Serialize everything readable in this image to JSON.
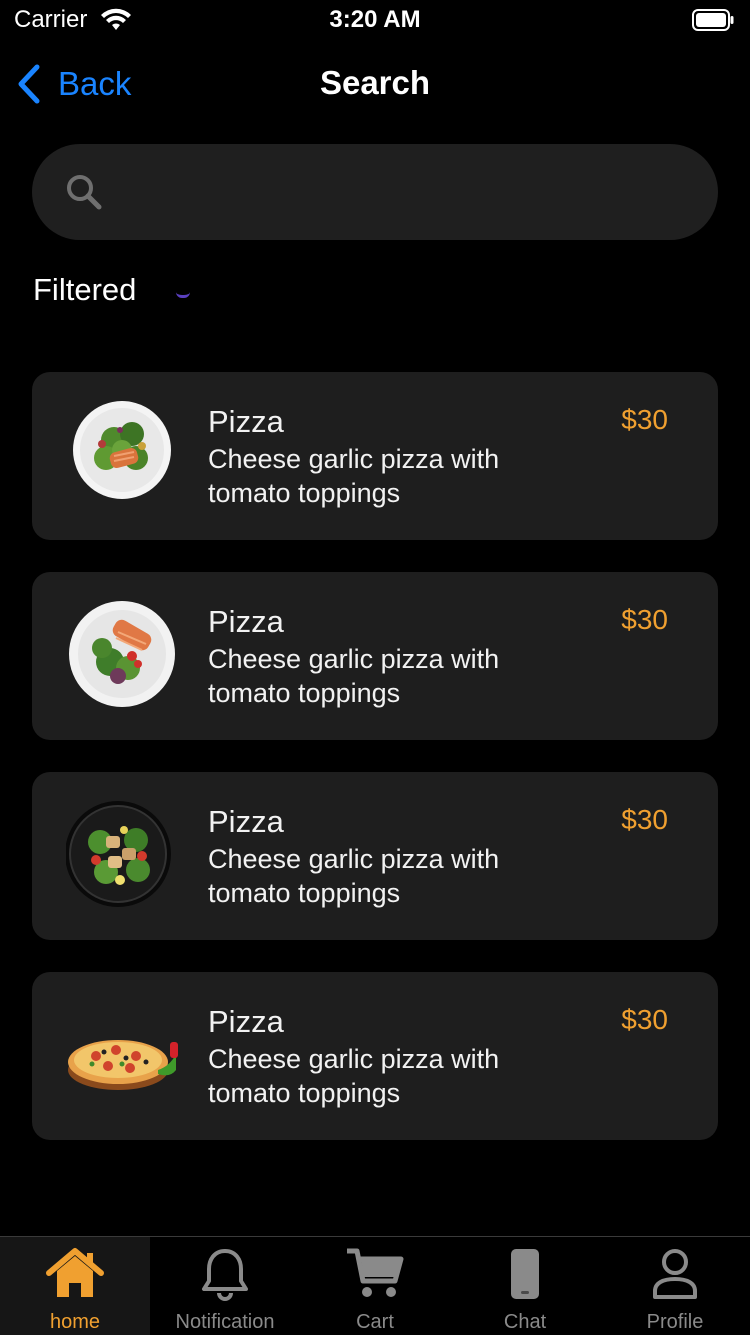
{
  "status_bar": {
    "carrier": "Carrier",
    "time": "3:20 AM"
  },
  "nav": {
    "back_label": "Back",
    "title": "Search"
  },
  "search": {
    "value": "",
    "placeholder": ""
  },
  "filter": {
    "label": "Filtered"
  },
  "results": [
    {
      "name": "Pizza",
      "description": "Cheese garlic pizza with tomato toppings",
      "price": "$30",
      "image": "salmon-salad-plate"
    },
    {
      "name": "Pizza",
      "description": "Cheese garlic pizza with tomato toppings",
      "price": "$30",
      "image": "salmon-salad-plate-2"
    },
    {
      "name": "Pizza",
      "description": "Cheese garlic pizza with tomato toppings",
      "price": "$30",
      "image": "chicken-salad-bowl"
    },
    {
      "name": "Pizza",
      "description": "Cheese garlic pizza with tomato toppings",
      "price": "$30",
      "image": "pizza"
    }
  ],
  "tabs": [
    {
      "label": "home",
      "icon": "home-icon",
      "active": true
    },
    {
      "label": "Notification",
      "icon": "bell-icon",
      "active": false
    },
    {
      "label": "Cart",
      "icon": "cart-icon",
      "active": false
    },
    {
      "label": "Chat",
      "icon": "phone-icon",
      "active": false
    },
    {
      "label": "Profile",
      "icon": "person-icon",
      "active": false
    }
  ],
  "colors": {
    "accent": "#f0a030",
    "link": "#1a84ff",
    "card_bg": "#1e1e1e",
    "background": "#000000"
  }
}
